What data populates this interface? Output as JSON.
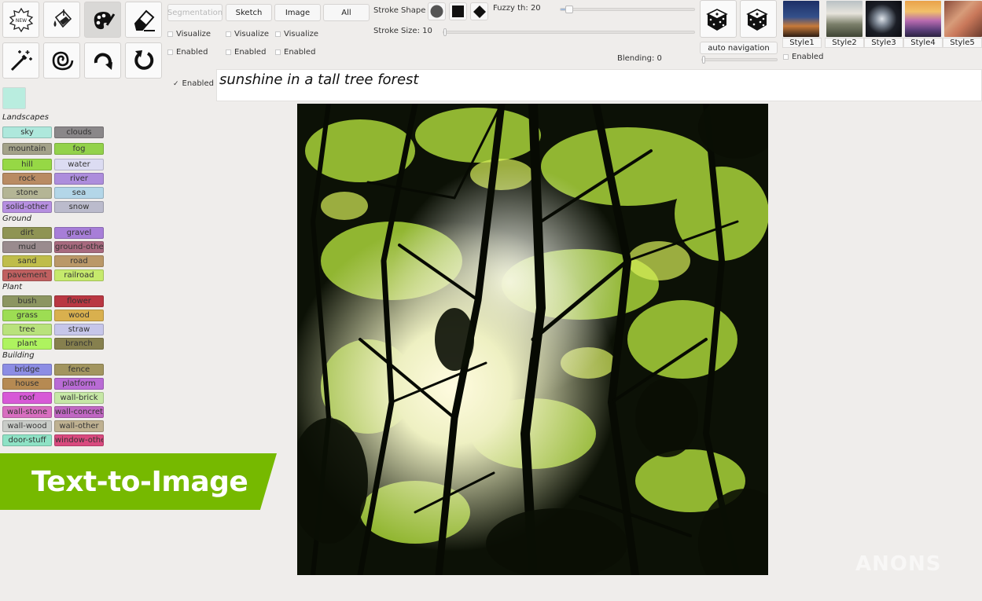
{
  "toolbar": {
    "tools": [
      {
        "name": "new-icon",
        "text": "NEW"
      },
      {
        "name": "paint-bucket-icon"
      },
      {
        "name": "palette-icon"
      },
      {
        "name": "eraser-icon"
      },
      {
        "name": "magic-wand-icon"
      },
      {
        "name": "spiral-icon"
      },
      {
        "name": "redo-icon"
      },
      {
        "name": "refresh-icon"
      }
    ]
  },
  "modes": {
    "segmentation": "Segmentation",
    "sketch": "Sketch",
    "image": "Image",
    "all": "All"
  },
  "checks": {
    "visualize": "Visualize",
    "enabled": "Enabled",
    "text_enabled": "Enabled"
  },
  "stroke": {
    "shape_label": "Stroke Shape",
    "size_label": "Stroke Size: 10",
    "size_value": 10,
    "fuzzy_label": "Fuzzy th: 20",
    "fuzzy_value": 20
  },
  "blending": {
    "label": "Blending: 0"
  },
  "navigation": {
    "auto_label": "auto navigation",
    "enabled": "Enabled"
  },
  "styles": [
    "Style1",
    "Style2",
    "Style3",
    "Style4",
    "Style5"
  ],
  "categories": {
    "landscapes": "Landscapes",
    "ground": "Ground",
    "plant": "Plant",
    "building": "Building"
  },
  "labels": {
    "sky": "sky",
    "clouds": "clouds",
    "mountain": "mountain",
    "fog": "fog",
    "hill": "hill",
    "water": "water",
    "rock": "rock",
    "river": "river",
    "stone": "stone",
    "sea": "sea",
    "solid_other": "solid-other",
    "snow": "snow",
    "dirt": "dirt",
    "gravel": "gravel",
    "mud": "mud",
    "ground_other": "ground-other",
    "sand": "sand",
    "road": "road",
    "pavement": "pavement",
    "railroad": "railroad",
    "bush": "bush",
    "flower": "flower",
    "grass": "grass",
    "wood": "wood",
    "tree": "tree",
    "straw": "straw",
    "plant": "plant",
    "branch": "branch",
    "bridge": "bridge",
    "fence": "fence",
    "house": "house",
    "platform": "platform",
    "roof": "roof",
    "wall_brick": "wall-brick",
    "wall_stone": "wall-stone",
    "wall_concrete": "wall-concrete",
    "wall_wood": "wall-wood",
    "wall_other": "wall-other",
    "door_stuff": "door-stuff",
    "window_other": "window-other"
  },
  "label_colors": {
    "sky": "#aee8dc",
    "clouds": "#8a8789",
    "mountain": "#a3a289",
    "fog": "#93d24a",
    "hill": "#96d845",
    "water": "#dcdcf2",
    "rock": "#b98b63",
    "river": "#ad8ddc",
    "stone": "#b4b595",
    "sea": "#b3d6e8",
    "solid_other": "#b68fe0",
    "snow": "#bbbbcc",
    "dirt": "#8f9454",
    "gravel": "#a77ed8",
    "mud": "#9a8b8e",
    "ground_other": "#a86a7f",
    "sand": "#bfbd4a",
    "road": "#ba9868",
    "pavement": "#c06060",
    "railroad": "#c6ea6c",
    "bush": "#8c9561",
    "flower": "#b93742",
    "grass": "#9ddd53",
    "wood": "#d9b04e",
    "tree": "#b9e27c",
    "straw": "#c6c6ea",
    "plant": "#aef35f",
    "branch": "#86804e",
    "bridge": "#8c8de4",
    "fence": "#a2955f",
    "house": "#b68a52",
    "platform": "#b96bd5",
    "roof": "#d759d7",
    "wall_brick": "#c6e8a6",
    "wall_stone": "#d86ec0",
    "wall_concrete": "#c067c3",
    "wall_wood": "#c9ccc8",
    "wall_other": "#bfb191",
    "door_stuff": "#8ee2c5",
    "window_other": "#d94a7e"
  },
  "prompt": {
    "text": "sunshine in a tall tree forest"
  },
  "banner": {
    "text": "Text-to-Image"
  },
  "watermark": {
    "text": "ANONS"
  },
  "colors": {
    "accent_green": "#76b900",
    "selected_swatch": "#b9eddf"
  }
}
